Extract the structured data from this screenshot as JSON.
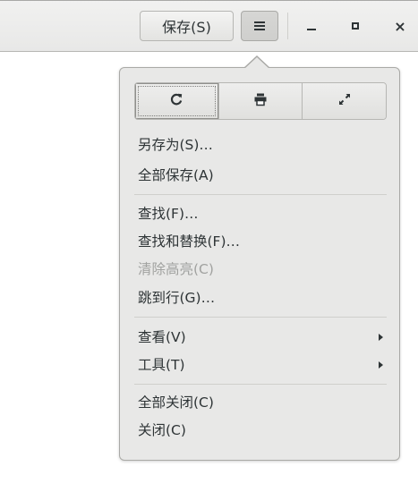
{
  "header": {
    "save_label": "保存(S)",
    "menu_icon": "hamburger-icon",
    "window_controls": [
      "minimize-icon",
      "maximize-icon",
      "close-icon"
    ],
    "close_glyph": "×"
  },
  "popover": {
    "icons": [
      "reload-icon",
      "print-icon",
      "fullscreen-icon"
    ],
    "sections": [
      [
        "另存为(S)…",
        "全部保存(A)"
      ],
      [
        "查找(F)…",
        "查找和替换(F)…",
        "清除高亮(C)",
        "跳到行(G)…"
      ],
      [
        "查看(V)",
        "工具(T)"
      ],
      [
        "全部关闭(C)",
        "关闭(C)"
      ]
    ],
    "save_as": "另存为(S)…",
    "save_all": "全部保存(A)",
    "find": "查找(F)…",
    "find_replace": "查找和替换(F)…",
    "clear_highlight": "清除高亮(C)",
    "clear_highlight_enabled": false,
    "goto_line": "跳到行(G)…",
    "view": "查看(V)",
    "tools": "工具(T)",
    "close_all": "全部关闭(C)",
    "close": "关闭(C)"
  }
}
